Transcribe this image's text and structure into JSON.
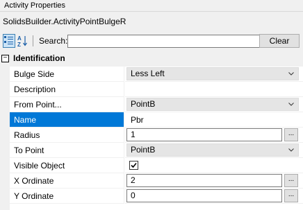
{
  "panel": {
    "title": "Activity Properties",
    "object_name": "SolidsBuilder.ActivityPointBulgeR"
  },
  "toolbar": {
    "categorized_icon": "categorized-view-icon",
    "alphabetical_icon": "sort-alphabetical-icon",
    "search_label": "Search:",
    "search_value": "",
    "clear_label": "Clear"
  },
  "category": {
    "toggle_glyph": "−",
    "label": "Identification"
  },
  "properties": [
    {
      "name": "Bulge Side",
      "value": "Less Left",
      "editor": "dropdown"
    },
    {
      "name": "Description",
      "value": "",
      "editor": "text"
    },
    {
      "name": "From Point...",
      "value": "PointB",
      "editor": "dropdown"
    },
    {
      "name": "Name",
      "value": "Pbr",
      "editor": "text",
      "selected": true
    },
    {
      "name": "Radius",
      "value": "1",
      "editor": "textbox-ellipsis"
    },
    {
      "name": "To Point",
      "value": "PointB",
      "editor": "dropdown"
    },
    {
      "name": "Visible Object",
      "value": "checked",
      "editor": "checkbox"
    },
    {
      "name": "X Ordinate",
      "value": "2",
      "editor": "textbox-ellipsis"
    },
    {
      "name": "Y Ordinate",
      "value": "0",
      "editor": "textbox-ellipsis"
    }
  ],
  "ellipsis_label": "...",
  "colors": {
    "selection": "#0078d7",
    "gutter": "#f0f0f0",
    "dropdown_bg": "#e5e5e5"
  }
}
